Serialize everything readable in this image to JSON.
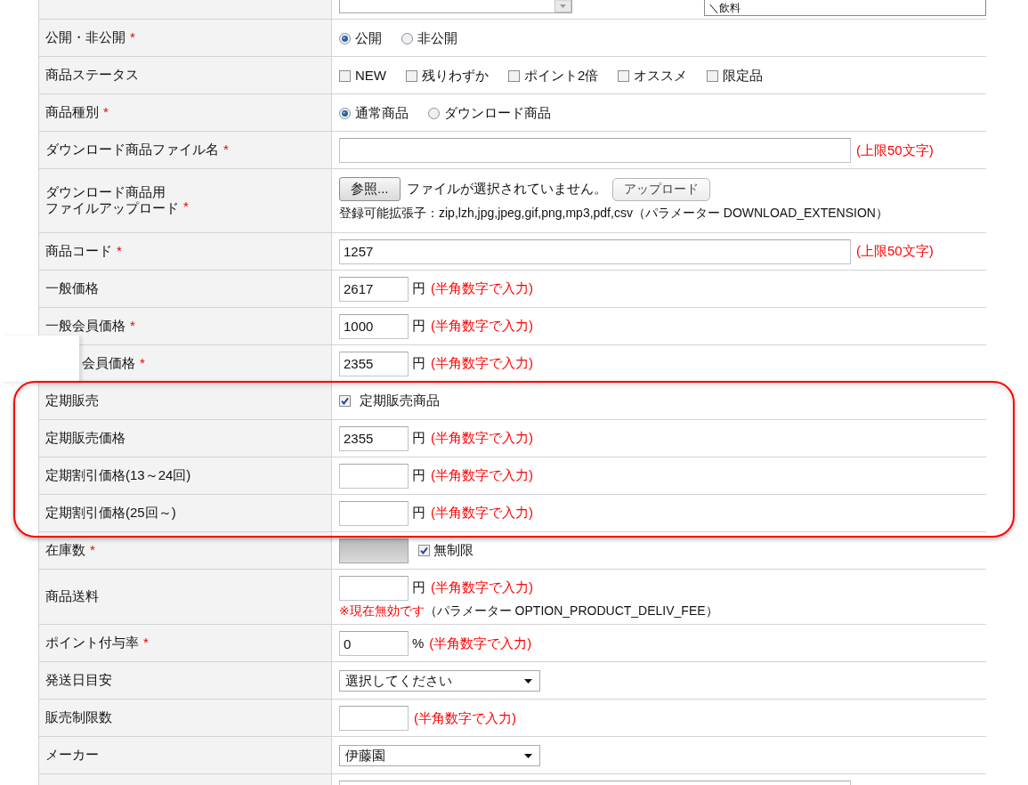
{
  "top_row": {
    "list_text": "＼飲料"
  },
  "rows": [
    {
      "kind": "radio",
      "label": "公開・非公開",
      "required_mark": "*",
      "highlighted": false,
      "masked": false,
      "options": [
        {
          "label": "公開",
          "selected": true
        },
        {
          "label": "非公開",
          "selected": false
        }
      ]
    },
    {
      "kind": "checks",
      "label": "商品ステータス",
      "highlighted": false,
      "masked": false,
      "options": [
        {
          "label": "NEW",
          "checked": false
        },
        {
          "label": "残りわずか",
          "checked": false
        },
        {
          "label": "ポイント2倍",
          "checked": false
        },
        {
          "label": "オススメ",
          "checked": false
        },
        {
          "label": "限定品",
          "checked": false
        }
      ]
    },
    {
      "kind": "radio",
      "label": "商品種別",
      "required_mark": "*",
      "highlighted": false,
      "masked": false,
      "options": [
        {
          "label": "通常商品",
          "selected": true
        },
        {
          "label": "ダウンロード商品",
          "selected": false
        }
      ]
    },
    {
      "kind": "text",
      "label": "ダウンロード商品ファイル名",
      "required_mark": "*",
      "highlighted": false,
      "masked": false,
      "value": "",
      "hint": "(上限50文字)"
    },
    {
      "kind": "upload",
      "label_lines": [
        "ダウンロード商品用",
        "ファイルアップロード"
      ],
      "required_mark": "*",
      "highlighted": false,
      "masked": false,
      "browse_button": "参照...",
      "file_status": "ファイルが選択されていません。",
      "upload_button": "アップロード",
      "note": "登録可能拡張子：zip,lzh,jpg,jpeg,gif,png,mp3,pdf,csv（パラメーター DOWNLOAD_EXTENSION）"
    },
    {
      "kind": "text",
      "label": "商品コード",
      "required_mark": "*",
      "highlighted": false,
      "masked": false,
      "value": "1257",
      "hint": "(上限50文字)"
    },
    {
      "kind": "number",
      "label": "一般価格",
      "highlighted": false,
      "masked": false,
      "value": "2617",
      "unit": "円",
      "hint": "(半角数字で入力)"
    },
    {
      "kind": "number",
      "label": "一般会員価格",
      "required_mark": "*",
      "highlighted": false,
      "masked": false,
      "value": "1000",
      "unit": "円",
      "hint": "(半角数字で入力)"
    },
    {
      "kind": "number",
      "label": "会員価格",
      "required_mark": "*",
      "highlighted": false,
      "masked": true,
      "value": "2355",
      "unit": "円",
      "hint": "(半角数字で入力)"
    },
    {
      "kind": "check",
      "label": "定期販売",
      "highlighted": true,
      "masked": false,
      "option": {
        "label": "定期販売商品",
        "checked": true
      }
    },
    {
      "kind": "number",
      "label": "定期販売価格",
      "highlighted": true,
      "masked": false,
      "value": "2355",
      "unit": "円",
      "hint": "(半角数字で入力)"
    },
    {
      "kind": "number",
      "label": "定期割引価格(13～24回)",
      "highlighted": true,
      "masked": false,
      "value": "",
      "unit": "円",
      "hint": "(半角数字で入力)"
    },
    {
      "kind": "number",
      "label": "定期割引価格(25回～)",
      "highlighted": true,
      "masked": false,
      "value": "",
      "unit": "円",
      "hint": "(半角数字で入力)"
    },
    {
      "kind": "stock",
      "label": "在庫数",
      "required_mark": "*",
      "highlighted": false,
      "masked": false,
      "disabled": true,
      "option": {
        "label": "無制限",
        "checked": true
      }
    },
    {
      "kind": "number",
      "label": "商品送料",
      "highlighted": false,
      "masked": false,
      "value": "",
      "unit": "円",
      "hint": "(半角数字で入力)",
      "note_warning": "※現在無効です",
      "note": "（パラメーター OPTION_PRODUCT_DELIV_FEE）"
    },
    {
      "kind": "number",
      "label": "ポイント付与率",
      "required_mark": "*",
      "highlighted": false,
      "masked": false,
      "value": "0",
      "unit": "%",
      "hint": "(半角数字で入力)"
    },
    {
      "kind": "select",
      "label": "発送日目安",
      "highlighted": false,
      "masked": false,
      "value": "選択してください"
    },
    {
      "kind": "number",
      "label": "販売制限数",
      "highlighted": false,
      "masked": false,
      "value": "",
      "hint": "(半角数字で入力)"
    },
    {
      "kind": "select",
      "label": "メーカー",
      "highlighted": false,
      "masked": false,
      "value": "伊藤園"
    },
    {
      "kind": "text",
      "highlighted": false,
      "masked": false,
      "value": ""
    }
  ]
}
